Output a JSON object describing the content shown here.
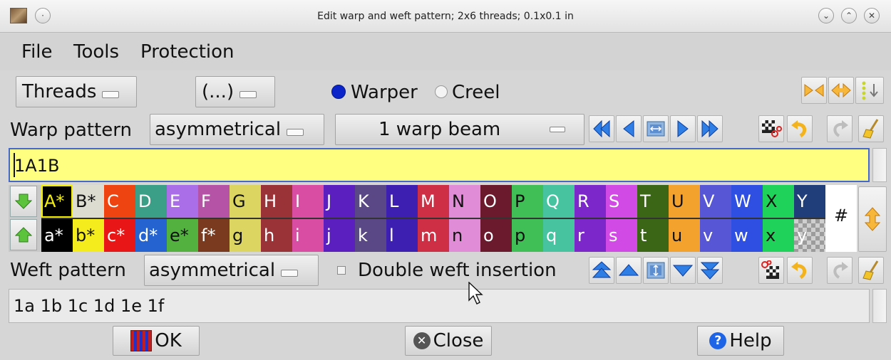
{
  "window": {
    "title": "Edit warp and weft pattern; 2x6 threads; 0.1x0.1 in",
    "minimize_glyph": "⌄",
    "maximize_glyph": "⌃",
    "close_glyph": "✕"
  },
  "menu": {
    "file": "File",
    "tools": "Tools",
    "protection": "Protection"
  },
  "toolbar": {
    "threads": "Threads",
    "more": "(...)",
    "warper": "Warper",
    "creel": "Creel",
    "warper_selected": true
  },
  "warp": {
    "label": "Warp pattern",
    "symmetry": "asymmetrical",
    "beam": "1 warp beam",
    "pattern": "1A1B"
  },
  "palette": {
    "upper": [
      {
        "label": "A*",
        "color": "#f5f000",
        "bg": "#000000",
        "selected": true
      },
      {
        "label": "B*",
        "color": "#111111",
        "bg": "#dcdcd0"
      },
      {
        "label": "C",
        "color": "#ffffff",
        "bg": "#ee4411"
      },
      {
        "label": "D",
        "color": "#ffffff",
        "bg": "#3b9e86"
      },
      {
        "label": "E",
        "color": "#ffffff",
        "bg": "#a96ee8"
      },
      {
        "label": "F",
        "color": "#ffffff",
        "bg": "#b553a6"
      },
      {
        "label": "G",
        "color": "#111111",
        "bg": "#dcd562"
      },
      {
        "label": "H",
        "color": "#ffffff",
        "bg": "#9a3338"
      },
      {
        "label": "I",
        "color": "#ffffff",
        "bg": "#d94da2"
      },
      {
        "label": "J",
        "color": "#ffffff",
        "bg": "#5b1fbf"
      },
      {
        "label": "K",
        "color": "#ffffff",
        "bg": "#5a4886"
      },
      {
        "label": "L",
        "color": "#ffffff",
        "bg": "#3d20b2"
      },
      {
        "label": "M",
        "color": "#ffffff",
        "bg": "#cf2f44"
      },
      {
        "label": "N",
        "color": "#111111",
        "bg": "#e08cd7"
      },
      {
        "label": "O",
        "color": "#ffffff",
        "bg": "#6b1a2e"
      },
      {
        "label": "P",
        "color": "#111111",
        "bg": "#3fbf55"
      },
      {
        "label": "Q",
        "color": "#ffffff",
        "bg": "#48c39f"
      },
      {
        "label": "R",
        "color": "#ffffff",
        "bg": "#7c27c9"
      },
      {
        "label": "S",
        "color": "#ffffff",
        "bg": "#d14ae6"
      },
      {
        "label": "T",
        "color": "#ffffff",
        "bg": "#3a6615"
      },
      {
        "label": "U",
        "color": "#111111",
        "bg": "#f3a22e"
      },
      {
        "label": "V",
        "color": "#ffffff",
        "bg": "#5757d6"
      },
      {
        "label": "W",
        "color": "#ffffff",
        "bg": "#2f4fe3"
      },
      {
        "label": "X",
        "color": "#111111",
        "bg": "#1fd25a"
      },
      {
        "label": "Y",
        "color": "#ffffff",
        "bg": "#1f3e7a"
      }
    ],
    "lower": [
      {
        "label": "a*",
        "color": "#ffffff",
        "bg": "#000000"
      },
      {
        "label": "b*",
        "color": "#111111",
        "bg": "#f5ec1d"
      },
      {
        "label": "c*",
        "color": "#ffffff",
        "bg": "#e81616"
      },
      {
        "label": "d*",
        "color": "#ffffff",
        "bg": "#2563d1"
      },
      {
        "label": "e*",
        "color": "#111111",
        "bg": "#52b13f"
      },
      {
        "label": "f*",
        "color": "#ffffff",
        "bg": "#7a3a1f"
      },
      {
        "label": "g",
        "color": "#111111",
        "bg": "#dcd562"
      },
      {
        "label": "h",
        "color": "#ffffff",
        "bg": "#9a3338"
      },
      {
        "label": "i",
        "color": "#ffffff",
        "bg": "#d94da2"
      },
      {
        "label": "j",
        "color": "#ffffff",
        "bg": "#5b1fbf"
      },
      {
        "label": "k",
        "color": "#ffffff",
        "bg": "#5a4886"
      },
      {
        "label": "l",
        "color": "#ffffff",
        "bg": "#3d20b2"
      },
      {
        "label": "m",
        "color": "#ffffff",
        "bg": "#cf2f44"
      },
      {
        "label": "n",
        "color": "#111111",
        "bg": "#e08cd7"
      },
      {
        "label": "o",
        "color": "#ffffff",
        "bg": "#6b1a2e"
      },
      {
        "label": "p",
        "color": "#111111",
        "bg": "#3fbf55"
      },
      {
        "label": "q",
        "color": "#ffffff",
        "bg": "#48c39f"
      },
      {
        "label": "r",
        "color": "#ffffff",
        "bg": "#7c27c9"
      },
      {
        "label": "s",
        "color": "#ffffff",
        "bg": "#d14ae6"
      },
      {
        "label": "t",
        "color": "#ffffff",
        "bg": "#3a6615"
      },
      {
        "label": "u",
        "color": "#111111",
        "bg": "#f3a22e"
      },
      {
        "label": "v",
        "color": "#ffffff",
        "bg": "#5757d6"
      },
      {
        "label": "w",
        "color": "#ffffff",
        "bg": "#2f4fe3"
      },
      {
        "label": "x",
        "color": "#111111",
        "bg": "#1fd25a"
      },
      {
        "label": "y",
        "color": "#ffffff",
        "bg": "checker"
      }
    ],
    "hash": "#"
  },
  "weft": {
    "label": "Weft pattern",
    "symmetry": "asymmetrical",
    "double_insertion": "Double weft insertion",
    "double_insertion_checked": false,
    "pattern": "1a 1b 1c 1d 1e 1f"
  },
  "buttons": {
    "ok": "OK",
    "close": "Close",
    "help": "Help"
  },
  "colors": {
    "warp_entry_bg": "#ffff80",
    "weft_entry_bg": "#eaeaea",
    "accent_blue": "#1e64e6",
    "warn_orange": "#f5a524"
  }
}
